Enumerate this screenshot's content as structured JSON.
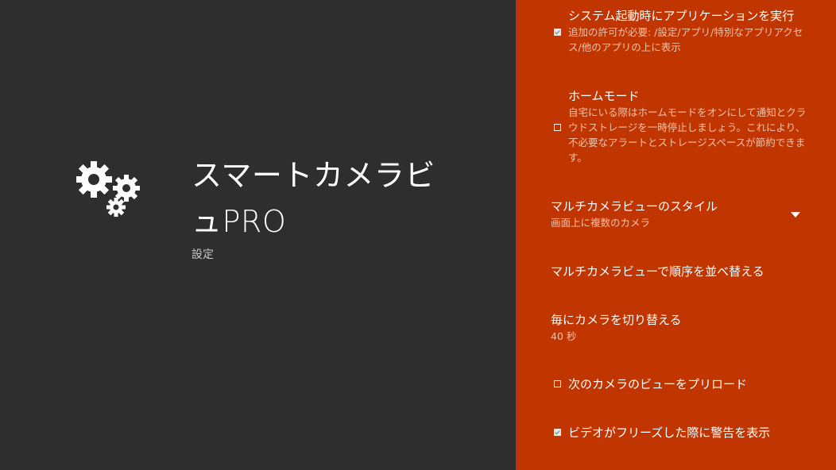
{
  "app": {
    "title": "スマートカメラビュPRO",
    "subtitle": "設定",
    "icon": "gears-icon"
  },
  "settings": {
    "run_on_boot": {
      "title": "システム起動時にアプリケーションを実行",
      "summary": "追加の許可が必要: /設定/アプリ/特別なアプリアクセス/他のアプリの上に表示",
      "checked": true
    },
    "home_mode": {
      "title": "ホームモード",
      "summary": "自宅にいる際はホームモードをオンにして通知とクラウドストレージを一時停止しましょう。これにより、不必要なアラートとストレージスペースが節約できます。",
      "checked": false
    },
    "multi_view_style": {
      "title": "マルチカメラビューのスタイル",
      "summary": "画面上に複数のカメラ"
    },
    "reorder": {
      "title": "マルチカメラビューで順序を並べ替える"
    },
    "switch_interval": {
      "title": "毎にカメラを切り替える",
      "summary": "40 秒"
    },
    "preload_next": {
      "title": "次のカメラのビューをプリロード",
      "checked": false
    },
    "freeze_warning": {
      "title": "ビデオがフリーズした際に警告を表示",
      "checked": true
    }
  },
  "colors": {
    "background": "#2e2e2e",
    "panel": "#c13500",
    "summary_text": "#f2c3ad"
  }
}
